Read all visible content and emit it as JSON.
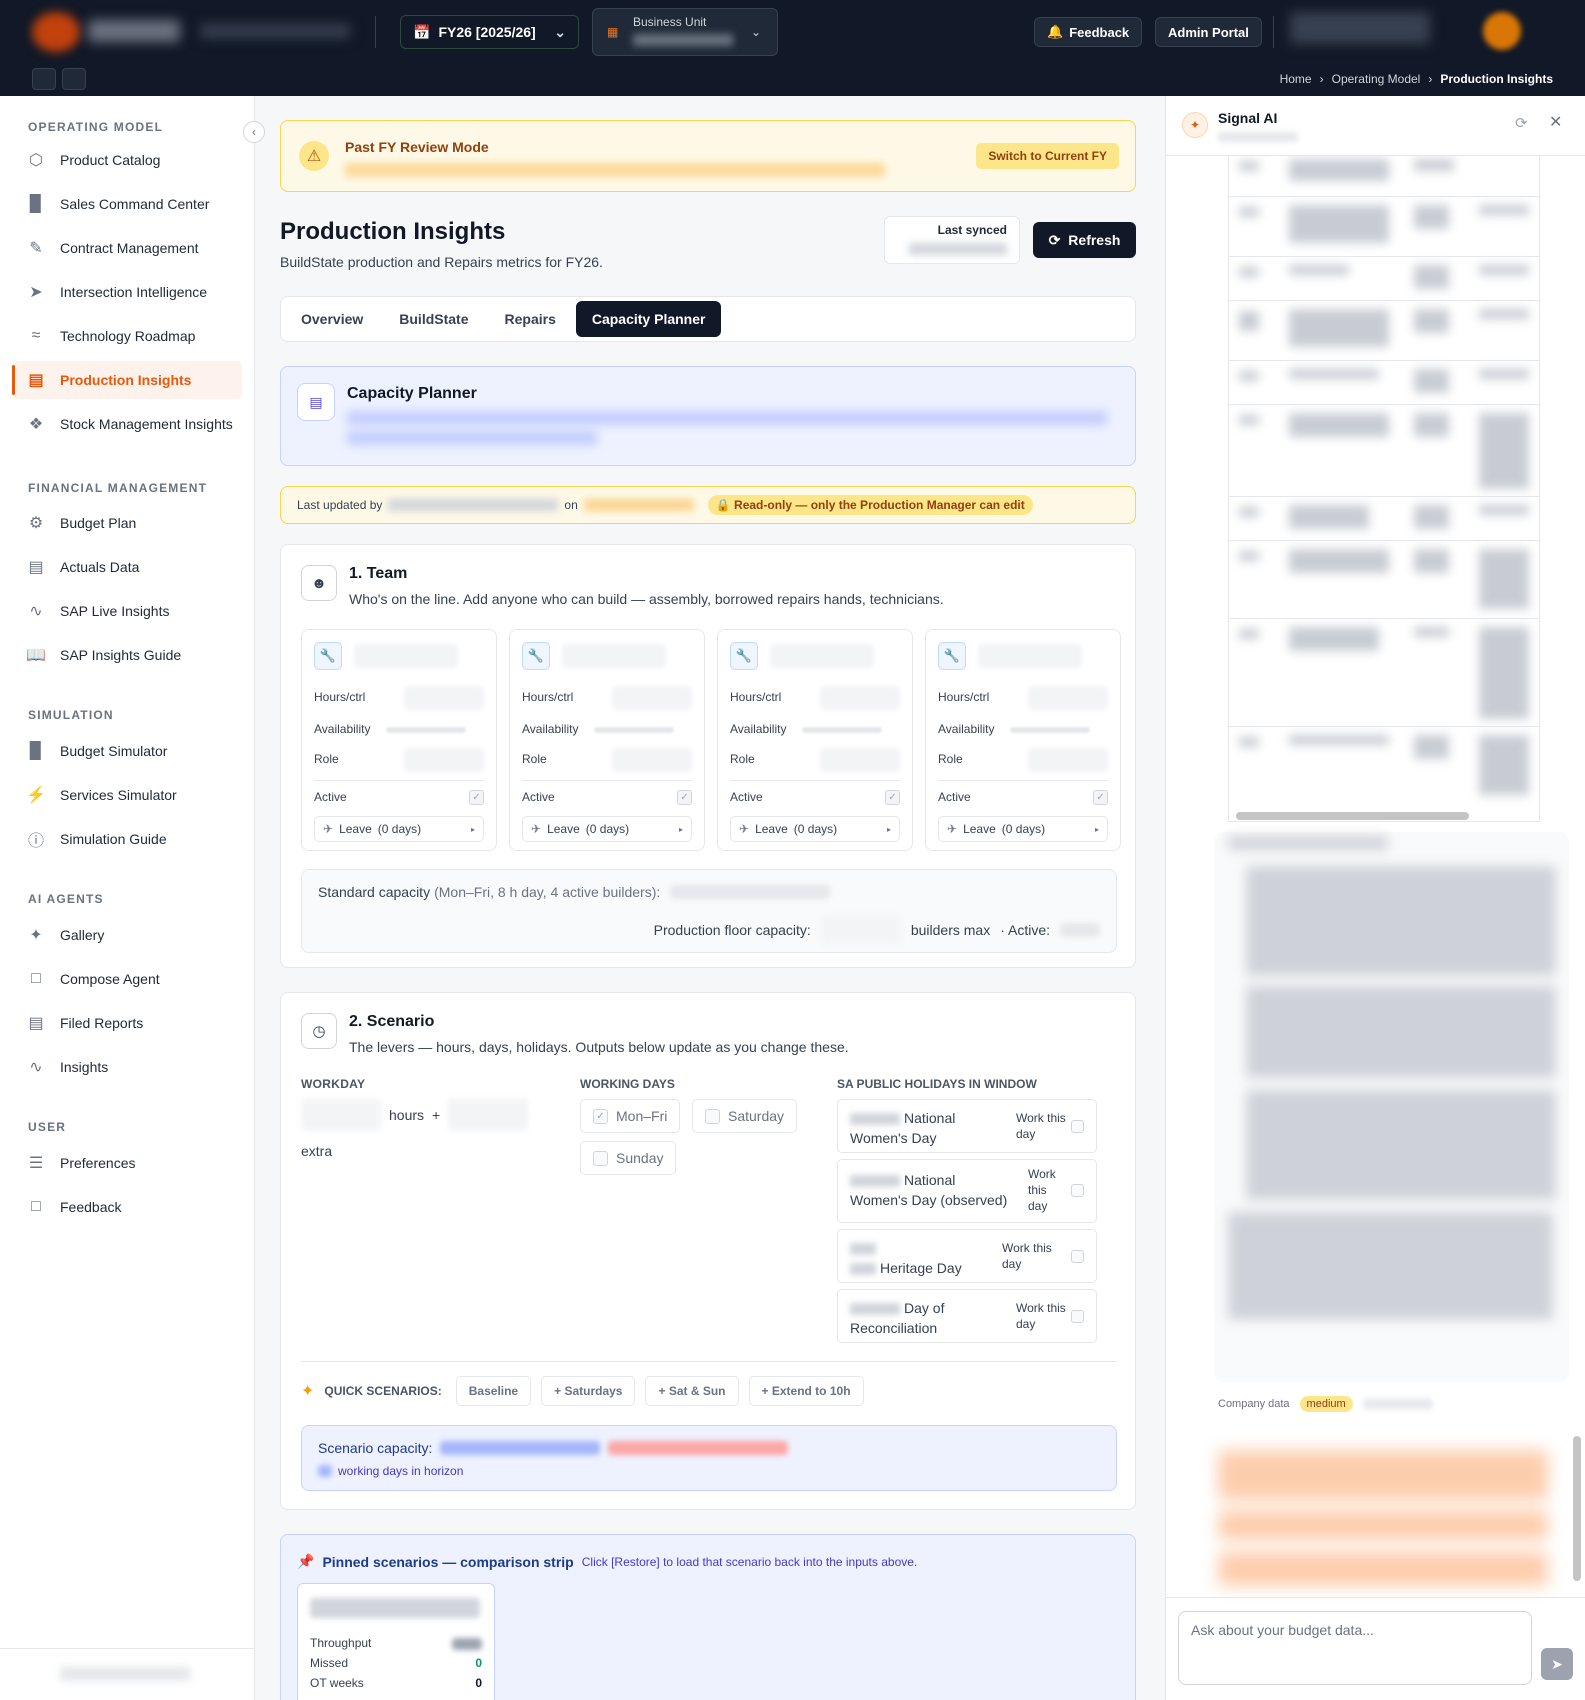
{
  "topbar": {
    "fy_label": "FY26 [2025/26]",
    "business_unit_label": "Business Unit",
    "feedback_label": "Feedback",
    "admin_portal_label": "Admin Portal"
  },
  "breadcrumb": [
    "Home",
    "Operating Model",
    "Production Insights"
  ],
  "sidebar": {
    "sections": [
      {
        "title": "OPERATING MODEL",
        "items": [
          {
            "label": "Product Catalog",
            "icon": "box-icon"
          },
          {
            "label": "Sales Command Center",
            "icon": "bar-chart-icon"
          },
          {
            "label": "Contract Management",
            "icon": "edit-document-icon"
          },
          {
            "label": "Intersection Intelligence",
            "icon": "send-icon"
          },
          {
            "label": "Technology Roadmap",
            "icon": "route-icon"
          },
          {
            "label": "Production Insights",
            "icon": "factory-icon",
            "active": true
          },
          {
            "label": "Stock Management Insights",
            "icon": "boxes-icon"
          }
        ]
      },
      {
        "title": "FINANCIAL MANAGEMENT",
        "items": [
          {
            "label": "Budget Plan",
            "icon": "gear-icon"
          },
          {
            "label": "Actuals Data",
            "icon": "document-icon"
          },
          {
            "label": "SAP Live Insights",
            "icon": "activity-icon"
          },
          {
            "label": "SAP Insights Guide",
            "icon": "book-icon"
          }
        ]
      },
      {
        "title": "SIMULATION",
        "items": [
          {
            "label": "Budget Simulator",
            "icon": "bar-chart-icon"
          },
          {
            "label": "Services Simulator",
            "icon": "zap-icon"
          },
          {
            "label": "Simulation Guide",
            "icon": "help-circle-icon"
          }
        ]
      },
      {
        "title": "AI AGENTS",
        "items": [
          {
            "label": "Gallery",
            "icon": "sparkles-icon"
          },
          {
            "label": "Compose Agent",
            "icon": "message-square-icon"
          },
          {
            "label": "Filed Reports",
            "icon": "file-icon"
          },
          {
            "label": "Insights",
            "icon": "activity-icon"
          }
        ]
      },
      {
        "title": "USER",
        "items": [
          {
            "label": "Preferences",
            "icon": "sliders-icon"
          },
          {
            "label": "Feedback",
            "icon": "message-square-icon"
          }
        ]
      }
    ]
  },
  "banner": {
    "title": "Past FY Review Mode",
    "switch_label": "Switch to Current FY"
  },
  "page": {
    "title": "Production Insights",
    "subtitle": "BuildState production and Repairs metrics for FY26.",
    "last_synced_label": "Last synced",
    "refresh_label": "Refresh"
  },
  "tabs": [
    {
      "label": "Overview"
    },
    {
      "label": "BuildState"
    },
    {
      "label": "Repairs"
    },
    {
      "label": "Capacity Planner",
      "active": true
    }
  ],
  "capacity_planner": {
    "title": "Capacity Planner"
  },
  "last_updated": {
    "prefix": "Last updated by",
    "on": "on",
    "readonly": "Read-only — only the Production Manager can edit"
  },
  "team": {
    "title": "1. Team",
    "subtitle": "Who's on the line. Add anyone who can build — assembly, borrowed repairs hands, technicians.",
    "labels": {
      "hours": "Hours/ctrl",
      "availability": "Availability",
      "role": "Role",
      "active": "Active",
      "leave": "Leave",
      "leave_days": "(0 days)"
    },
    "member_count": 4,
    "standard_capacity_label": "Standard capacity",
    "standard_capacity_detail": "(Mon–Fri, 8 h day, 4 active builders):",
    "floor_capacity_label": "Production floor capacity:",
    "builders_max": "builders max",
    "active_label": "· Active:"
  },
  "scenario": {
    "title": "2. Scenario",
    "subtitle": "The levers — hours, days, holidays. Outputs below update as you change these.",
    "workday_label": "WORKDAY",
    "hours_label": "hours",
    "plus": "+",
    "extra_label": "extra",
    "working_days_label": "WORKING DAYS",
    "days": [
      {
        "label": "Mon–Fri",
        "checked": true
      },
      {
        "label": "Saturday",
        "checked": false
      },
      {
        "label": "Sunday",
        "checked": false
      }
    ],
    "holidays_label": "SA PUBLIC HOLIDAYS IN WINDOW",
    "holidays": [
      {
        "name_line1": "National",
        "name_line2": "Women's Day",
        "work": "Work this day"
      },
      {
        "name_line1": "National",
        "name_line2": "Women's Day (observed)",
        "work": "Work this day"
      },
      {
        "name_line1": "",
        "name_line2": "Heritage Day",
        "work": "Work this day"
      },
      {
        "name_line1": "Day of",
        "name_line2": "Reconciliation",
        "work": "Work this day"
      }
    ],
    "quick_label": "QUICK SCENARIOS:",
    "quick": [
      "Baseline",
      "+ Saturdays",
      "+ Sat & Sun",
      "+ Extend to 10h"
    ],
    "scenario_capacity_label": "Scenario capacity:",
    "working_days_horizon": "working days in horizon"
  },
  "pinned": {
    "title": "Pinned scenarios — comparison strip",
    "hint": "Click [Restore] to load that scenario back into the inputs above.",
    "throughput_label": "Throughput",
    "missed_label": "Missed",
    "missed_value": "0",
    "ot_label": "OT weeks",
    "ot_value": "0"
  },
  "chat": {
    "title": "Signal AI",
    "company_data": "Company data",
    "badge": "medium",
    "input_placeholder": "Ask about your budget data..."
  },
  "colors": {
    "accent": "#ea580c",
    "topbar": "#111827",
    "warn_bg": "#fef9e7"
  }
}
